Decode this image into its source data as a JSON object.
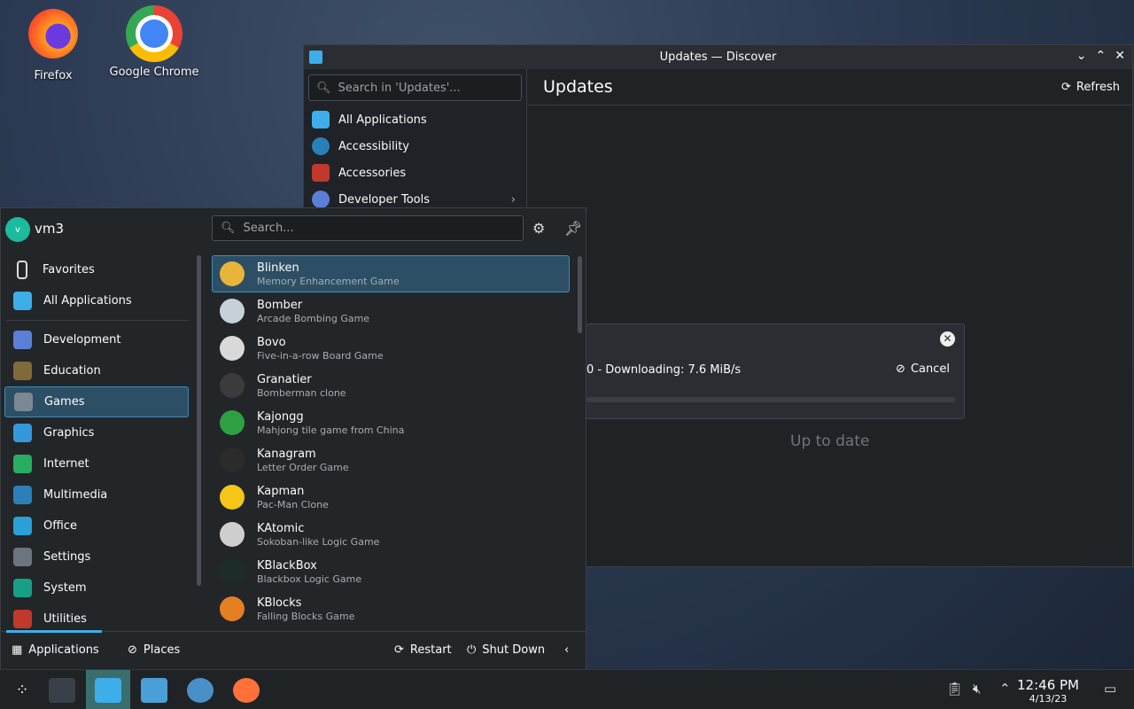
{
  "desktop": {
    "icons": [
      {
        "label": "Firefox"
      },
      {
        "label": "Google Chrome"
      }
    ]
  },
  "discover": {
    "title": "Updates — Discover",
    "search_placeholder": "Search in 'Updates'...",
    "nav": [
      {
        "label": "All Applications",
        "color": "#3daee9"
      },
      {
        "label": "Accessibility",
        "color": "#2980b9"
      },
      {
        "label": "Accessories",
        "color": "#c0392b"
      },
      {
        "label": "Developer Tools",
        "color": "#5b7fd6"
      }
    ],
    "header": "Updates",
    "refresh_label": "Refresh",
    "status_text": "Up to date",
    "progress": {
      "text": "0 - Downloading: 7.6 MiB/s",
      "cancel_label": "Cancel",
      "fill_fraction": 0.0
    }
  },
  "launcher": {
    "user": "vm3",
    "avatar_initial": "v",
    "search_placeholder": "Search...",
    "categories_top": [
      {
        "label": "Favorites",
        "icon": "bookmark-icon"
      },
      {
        "label": "All Applications",
        "icon": "grid-icon",
        "color": "#3daee9"
      }
    ],
    "categories": [
      {
        "label": "Development",
        "color": "#5b7fd6"
      },
      {
        "label": "Education",
        "color": "#7f6a3a"
      },
      {
        "label": "Games",
        "color": "#7b8894"
      },
      {
        "label": "Graphics",
        "color": "#3498db"
      },
      {
        "label": "Internet",
        "color": "#27ae60"
      },
      {
        "label": "Multimedia",
        "color": "#2c7fb8"
      },
      {
        "label": "Office",
        "color": "#2a9fd8"
      },
      {
        "label": "Settings",
        "color": "#6c757d"
      },
      {
        "label": "System",
        "color": "#16a085"
      },
      {
        "label": "Utilities",
        "color": "#c0392b"
      }
    ],
    "apps": [
      {
        "name": "Blinken",
        "desc": "Memory Enhancement Game",
        "color": "#e8b43a"
      },
      {
        "name": "Bomber",
        "desc": "Arcade Bombing Game",
        "color": "#c8d0d8"
      },
      {
        "name": "Bovo",
        "desc": "Five-in-a-row Board Game",
        "color": "#d9d9d9"
      },
      {
        "name": "Granatier",
        "desc": "Bomberman clone",
        "color": "#3b3b3b"
      },
      {
        "name": "Kajongg",
        "desc": "Mahjong tile game from China",
        "color": "#2ea043"
      },
      {
        "name": "Kanagram",
        "desc": "Letter Order Game",
        "color": "#2b2b2b"
      },
      {
        "name": "Kapman",
        "desc": "Pac-Man Clone",
        "color": "#f5c518"
      },
      {
        "name": "KAtomic",
        "desc": "Sokoban-like Logic Game",
        "color": "#cfcfcf"
      },
      {
        "name": "KBlackBox",
        "desc": "Blackbox Logic Game",
        "color": "#1e2b2b"
      },
      {
        "name": "KBlocks",
        "desc": "Falling Blocks Game",
        "color": "#e67e22"
      }
    ],
    "footer": {
      "applications": "Applications",
      "places": "Places",
      "restart": "Restart",
      "shutdown": "Shut Down"
    }
  },
  "taskbar": {
    "time": "12:46 PM",
    "date": "4/13/23"
  }
}
